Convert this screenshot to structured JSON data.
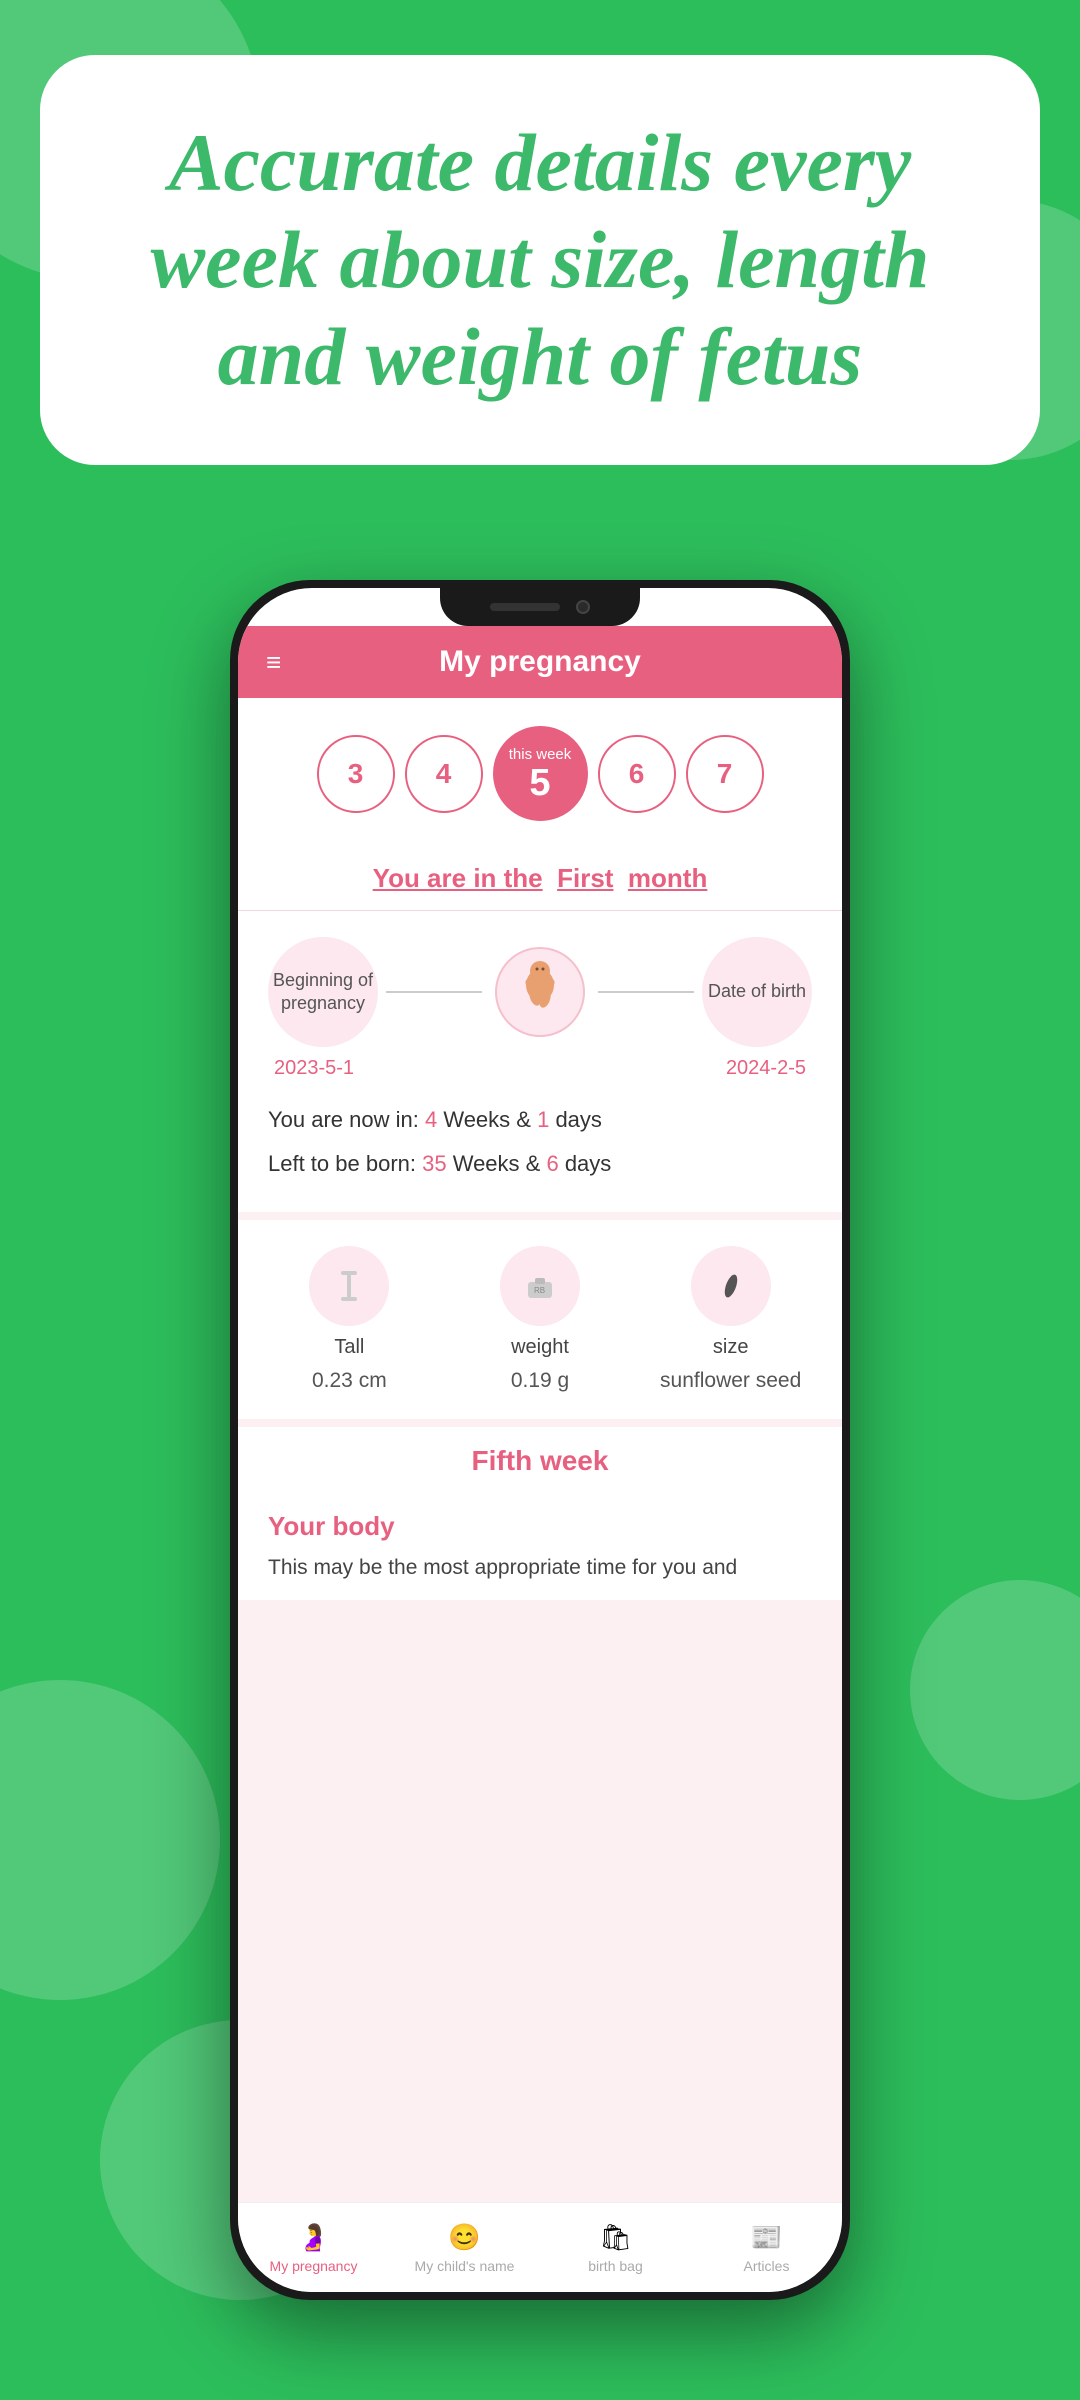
{
  "background": {
    "color": "#2dbe5c"
  },
  "header_card": {
    "title": "Accurate details every week about size, length and weight of fetus"
  },
  "app": {
    "header": {
      "title": "My pregnancy",
      "menu_icon": "≡"
    },
    "week_selector": {
      "weeks": [
        "3",
        "4",
        "5",
        "6",
        "7"
      ],
      "active_index": 2,
      "active_label": "this week",
      "active_number": "5"
    },
    "month_line": {
      "prefix": "You are in the",
      "month": "First",
      "suffix": "month"
    },
    "timeline": {
      "beginning_label": "Beginning of pregnancy",
      "date_birth_label": "Date of birth",
      "start_date": "2023-5-1",
      "end_date": "2024-2-5"
    },
    "progress": {
      "now_weeks": "4",
      "now_days": "1",
      "left_weeks": "35",
      "left_days": "6"
    },
    "stats": {
      "tall_label": "Tall",
      "tall_value": "0.23 cm",
      "weight_label": "weight",
      "weight_value": "0.19 g",
      "size_label": "size",
      "size_value": "sunflower seed"
    },
    "fifth_week": {
      "title": "Fifth week",
      "body_title": "Your body",
      "body_text": "This may be the most appropriate time for you and"
    },
    "bottom_nav": {
      "items": [
        {
          "label": "My pregnancy",
          "active": true
        },
        {
          "label": "My child's name",
          "active": false
        },
        {
          "label": "birth bag",
          "active": false
        },
        {
          "label": "Articles",
          "active": false
        }
      ]
    }
  }
}
